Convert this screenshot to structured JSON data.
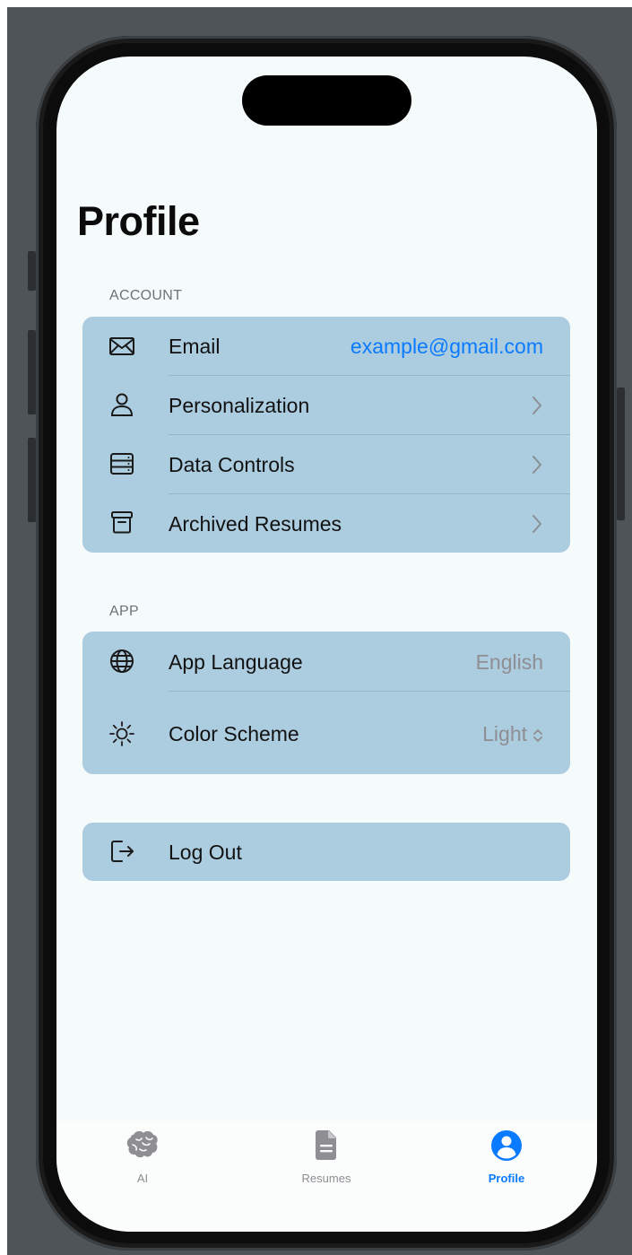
{
  "page": {
    "title": "Profile"
  },
  "account": {
    "header": "ACCOUNT",
    "rows": [
      {
        "icon": "envelope-icon",
        "label": "Email",
        "value": "example@gmail.com"
      },
      {
        "icon": "person-icon",
        "label": "Personalization",
        "trailing": "chevron-right-icon"
      },
      {
        "icon": "storage-icon",
        "label": "Data Controls",
        "trailing": "chevron-right-icon"
      },
      {
        "icon": "archive-box-icon",
        "label": "Archived Resumes",
        "trailing": "chevron-right-icon"
      }
    ]
  },
  "app": {
    "header": "APP",
    "rows": [
      {
        "icon": "globe-icon",
        "label": "App Language",
        "value": "English"
      },
      {
        "icon": "sun-icon",
        "label": "Color Scheme",
        "value": "Light",
        "trailing": "up-down-chevron-icon"
      }
    ]
  },
  "logout": {
    "icon": "logout-icon",
    "label": "Log Out"
  },
  "tabbar": {
    "tabs": [
      {
        "icon": "brain-icon",
        "label": "AI"
      },
      {
        "icon": "document-icon",
        "label": "Resumes"
      },
      {
        "icon": "person-circle-icon",
        "label": "Profile",
        "selected": true
      }
    ]
  },
  "colors": {
    "accent": "#0a7aff",
    "group_background": "#acccdf",
    "screen_background": "#f5fafb",
    "secondary_text": "#8e8e93"
  }
}
